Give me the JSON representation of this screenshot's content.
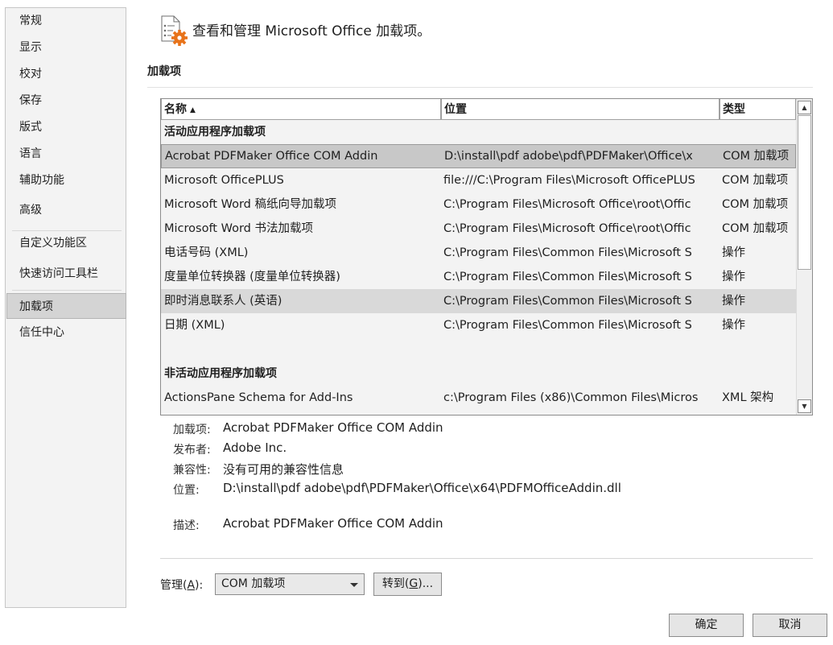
{
  "sidebar": {
    "items": [
      "常规",
      "显示",
      "校对",
      "保存",
      "版式",
      "语言",
      "辅助功能",
      "高级",
      "自定义功能区",
      "快速访问工具栏",
      "加载项",
      "信任中心"
    ],
    "selected": "加载项"
  },
  "header": {
    "title": "查看和管理 Microsoft Office 加载项。"
  },
  "section": {
    "title": "加载项"
  },
  "table": {
    "columns": [
      "名称",
      "位置",
      "类型"
    ],
    "sort_column": "名称",
    "active_group_label": "活动应用程序加载项",
    "inactive_group_label": "非活动应用程序加载项",
    "active_rows": [
      {
        "name": "Acrobat PDFMaker Office COM Addin",
        "location": "D:\\install\\pdf adobe\\pdf\\PDFMaker\\Office\\x",
        "type": "COM 加载项"
      },
      {
        "name": "Microsoft OfficePLUS",
        "location": "file:///C:\\Program Files\\Microsoft OfficePLUS",
        "type": "COM 加载项"
      },
      {
        "name": "Microsoft Word 稿纸向导加载项",
        "location": "C:\\Program Files\\Microsoft Office\\root\\Offic",
        "type": "COM 加载项"
      },
      {
        "name": "Microsoft Word 书法加载项",
        "location": "C:\\Program Files\\Microsoft Office\\root\\Offic",
        "type": "COM 加载项"
      },
      {
        "name": "电话号码 (XML)",
        "location": "C:\\Program Files\\Common Files\\Microsoft S",
        "type": "操作"
      },
      {
        "name": "度量单位转换器 (度量单位转换器)",
        "location": "C:\\Program Files\\Common Files\\Microsoft S",
        "type": "操作"
      },
      {
        "name": "即时消息联系人 (英语)",
        "location": "C:\\Program Files\\Common Files\\Microsoft S",
        "type": "操作"
      },
      {
        "name": "日期 (XML)",
        "location": "C:\\Program Files\\Common Files\\Microsoft S",
        "type": "操作"
      }
    ],
    "inactive_rows": [
      {
        "name": "ActionsPane Schema for Add-Ins",
        "location": "c:\\Program Files (x86)\\Common Files\\Micros",
        "type": "XML 架构"
      }
    ]
  },
  "details": {
    "addin_label": "加载项:",
    "addin_value": "Acrobat PDFMaker Office COM Addin",
    "publisher_label": "发布者:",
    "publisher_value": "Adobe Inc.",
    "compat_label": "兼容性:",
    "compat_value": "没有可用的兼容性信息",
    "location_label": "位置:",
    "location_value": "D:\\install\\pdf adobe\\pdf\\PDFMaker\\Office\\x64\\PDFMOfficeAddin.dll",
    "desc_label": "描述:",
    "desc_value": "Acrobat PDFMaker Office COM Addin"
  },
  "manage": {
    "label_prefix": "管理(",
    "label_key": "A",
    "label_suffix": "):",
    "selected": "COM 加载项",
    "goto_prefix": "转到(",
    "goto_key": "G",
    "goto_suffix": ")..."
  },
  "buttons": {
    "ok": "确定",
    "cancel": "取消"
  },
  "colors": {
    "accent_icon": "#e8731a",
    "selected_row": "#c8c8c8"
  }
}
